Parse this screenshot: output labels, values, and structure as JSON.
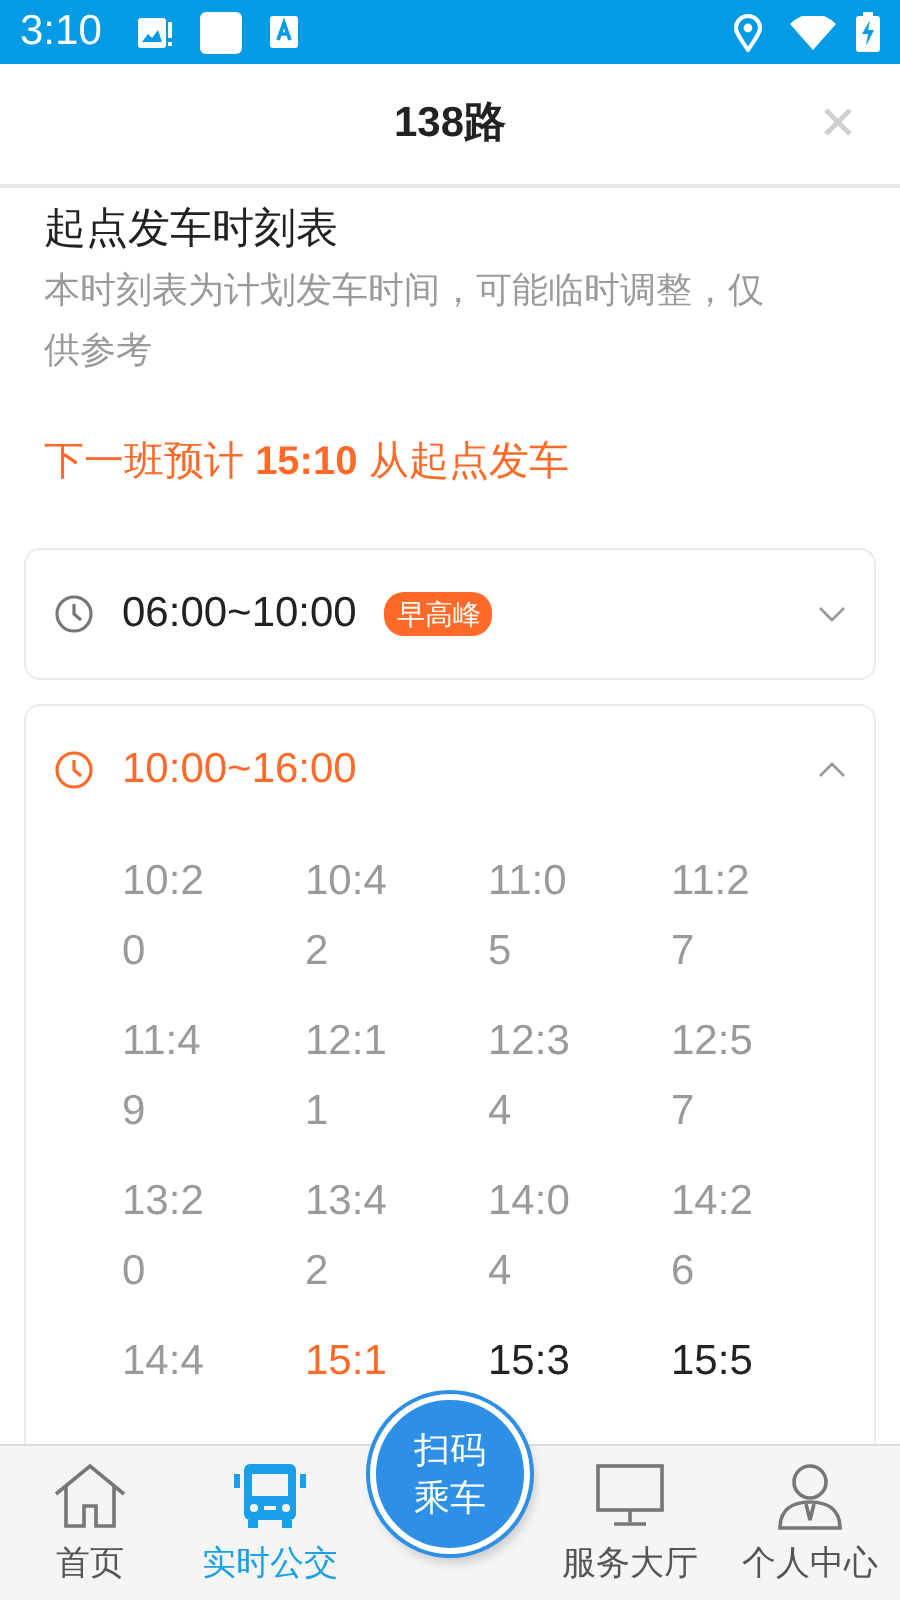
{
  "status_bar": {
    "time": "3:10"
  },
  "header": {
    "title": "138路"
  },
  "timetable": {
    "title": "起点发车时刻表",
    "note": "本时刻表为计划发车时间，可能临时调整，仅供参考",
    "next_departure": "下一班预计 **15:10** 从起点发车"
  },
  "periods": [
    {
      "range": "06:00~10:00",
      "tag": "早高峰",
      "expanded": false
    },
    {
      "range": "10:00~16:00",
      "expanded": true,
      "times": [
        {
          "time": "10:20",
          "kind": "past"
        },
        {
          "time": "10:42",
          "kind": "past"
        },
        {
          "time": "11:05",
          "kind": "past"
        },
        {
          "time": "11:27",
          "kind": "past"
        },
        {
          "time": "11:49",
          "kind": "past"
        },
        {
          "time": "12:11",
          "kind": "past"
        },
        {
          "time": "12:34",
          "kind": "past"
        },
        {
          "time": "12:57",
          "kind": "past"
        },
        {
          "time": "13:20",
          "kind": "past"
        },
        {
          "time": "13:42",
          "kind": "past"
        },
        {
          "time": "14:04",
          "kind": "past"
        },
        {
          "time": "14:26",
          "kind": "past"
        },
        {
          "time": "14:4",
          "kind": "past"
        },
        {
          "time": "15:1",
          "kind": "next"
        },
        {
          "time": "15:3",
          "kind": "upcoming"
        },
        {
          "time": "15:5",
          "kind": "upcoming"
        }
      ]
    }
  ],
  "bottom_nav": {
    "items": [
      {
        "label": "首页",
        "selected": false
      },
      {
        "label": "实时公交",
        "selected": true
      },
      {
        "label": "服务大厅",
        "selected": false
      },
      {
        "label": "个人中心",
        "selected": false
      }
    ],
    "scan_button": "扫码乘车"
  }
}
